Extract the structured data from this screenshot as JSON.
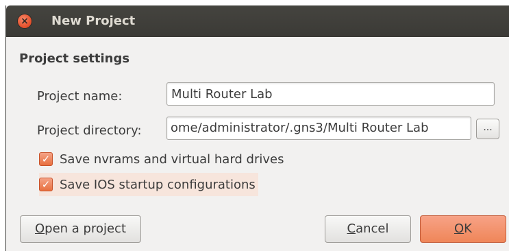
{
  "window": {
    "title": "New Project",
    "close_glyph": "×"
  },
  "settings": {
    "group_title": "Project settings",
    "project_name_label": "Project name:",
    "project_name_value": "Multi Router Lab",
    "project_directory_label": "Project directory:",
    "project_directory_value": "ome/administrator/.gns3/Multi Router Lab",
    "browse_label": "...",
    "checkboxes": [
      {
        "label": "Save nvrams and virtual hard drives",
        "checked": true
      },
      {
        "label": "Save IOS startup configurations",
        "checked": true
      }
    ],
    "check_glyph": "✓"
  },
  "buttons": {
    "open_project": {
      "mnemonic": "O",
      "rest": "pen a project"
    },
    "cancel": {
      "mnemonic": "C",
      "rest": "ancel"
    },
    "ok": {
      "mnemonic": "O",
      "rest": "K"
    }
  },
  "colors": {
    "accent": "#ef8659",
    "titlebar": "#3b3a36",
    "dialog_bg": "#f2f1f0"
  }
}
